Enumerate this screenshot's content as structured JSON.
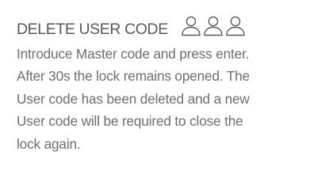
{
  "section": {
    "title": "DELETE USER CODE",
    "icon": "three-users-icon",
    "lines": [
      "Introduce Master code and press enter.",
      "After 30s the lock remains opened. The",
      "User code has been deleted and a new",
      "User code will be required to close the",
      "lock again."
    ]
  },
  "colors": {
    "title": "#5a5a5a",
    "text": "#6e6e6e",
    "icon_stroke": "#5a5a5a"
  }
}
